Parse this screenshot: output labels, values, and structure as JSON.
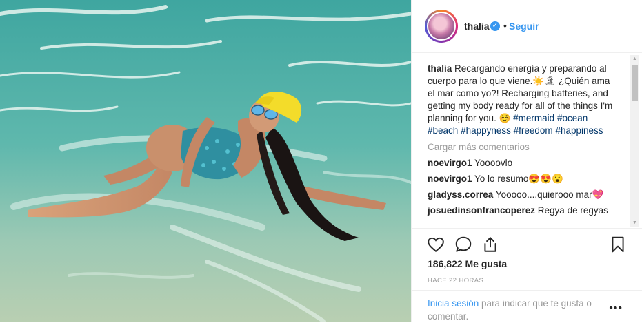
{
  "post": {
    "username": "thalia",
    "follow_label": "Seguir",
    "dot": "•",
    "verified_glyph": "✓"
  },
  "caption": {
    "username": "thalia",
    "text": "Recargando energía y preparando al cuerpo para lo que viene.☀️🏝 ¿Quién ama el mar como yo?! Recharging batteries, and getting my body ready for all of the things I'm planning for you. ☺️",
    "hashtags": [
      "#mermaid",
      "#ocean",
      "#beach",
      "#happyness",
      "#freedom",
      "#happiness"
    ]
  },
  "load_more": "Cargar más comentarios",
  "comments": [
    {
      "user": "noevirgo1",
      "text": "Yoooovlo"
    },
    {
      "user": "noevirgo1",
      "text": "Yo lo resumo😍😍😮"
    },
    {
      "user": "gladyss.correa",
      "text": "Yooooo....quierooo mar💖"
    },
    {
      "user": "josuedinsonfrancoperez",
      "text": "Regya de regyas"
    }
  ],
  "likes": "186,822 Me gusta",
  "timestamp": "HACE 22 HORAS",
  "footer": {
    "login_link": "Inicia sesión",
    "login_rest": " para indicar que te gusta o comentar.",
    "more": "•••"
  },
  "icons": {
    "like": "heart-icon",
    "comment": "comment-icon",
    "share": "share-icon",
    "save": "bookmark-icon"
  },
  "colors": {
    "link": "#3897f0",
    "hashtag": "#003569",
    "muted": "#999999",
    "text": "#262626"
  }
}
